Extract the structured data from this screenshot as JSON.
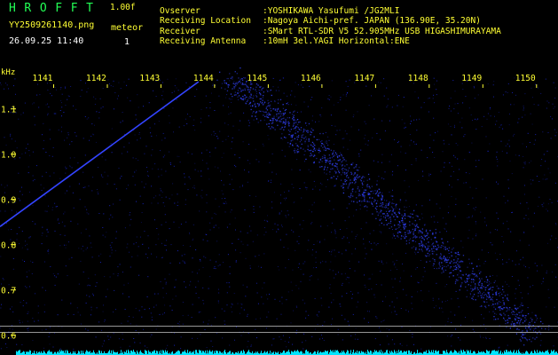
{
  "header": {
    "app_title": "HROFFT",
    "version": "1.00f",
    "filename": "YY2509261140.png",
    "timestamp": "26.09.25 11:40",
    "meteor_label": "meteor",
    "meteor_count": "1"
  },
  "info": [
    {
      "label": "Ovserver",
      "value": ":YOSHIKAWA Yasufumi /JG2MLI"
    },
    {
      "label": "Receiving Location",
      "value": ":Nagoya Aichi-pref. JAPAN (136.90E, 35.20N)"
    },
    {
      "label": "Receiver",
      "value": ":SMart RTL-SDR V5 52.905MHz USB HIGASHIMURAYAMA"
    },
    {
      "label": "Receiving Antenna",
      "value": ":10mH 3el.YAGI Horizontal:ENE"
    }
  ],
  "colors": {
    "header_green": "#22ff55",
    "header_yellow": "#ffff33",
    "axis_yellow": "#ffff33",
    "signal_blue": "#3344ff",
    "noise_blue": "#2030ff",
    "baseline_cyan": "#00e5ff"
  },
  "chart_data": {
    "type": "heatmap",
    "ylabel": "kHz",
    "time_ticks": [
      "1141",
      "1142",
      "1143",
      "1144",
      "1145",
      "1146",
      "1147",
      "1148",
      "1149",
      "1150"
    ],
    "freq_ticks": [
      "1.1",
      "1.0",
      "0.9",
      "0.8",
      "0.7",
      "0.6"
    ],
    "freq_tick_values": [
      1.1,
      1.0,
      0.9,
      0.8,
      0.7,
      0.6
    ],
    "ylim": [
      0.57,
      1.17
    ],
    "xlim_minutes": [
      1140.0,
      1150.4
    ],
    "reference_lines_khz": [
      0.62,
      0.606
    ],
    "signals": [
      {
        "kind": "line",
        "t_start": 1140.0,
        "f_start": 0.84,
        "t_end": 1143.7,
        "f_end": 1.16
      },
      {
        "kind": "diffuse-band",
        "t_start": 1144.3,
        "f_start": 1.17,
        "t_end": 1150.0,
        "f_end": 0.6
      }
    ]
  }
}
